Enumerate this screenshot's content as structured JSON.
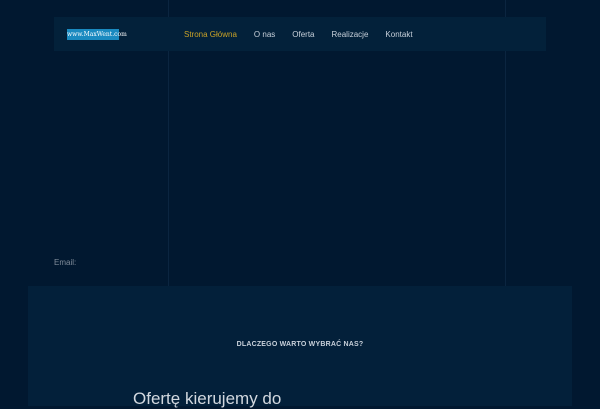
{
  "header": {
    "logo_text": "www.MaxWent.com",
    "nav": [
      {
        "label": "Strona Główna",
        "active": true
      },
      {
        "label": "O nas"
      },
      {
        "label": "Oferta"
      },
      {
        "label": "Realizacje"
      },
      {
        "label": "Kontakt"
      }
    ]
  },
  "contact": {
    "email_label": "Email:"
  },
  "why_section": {
    "eyebrow": "DLACZEGO WARTO WYBRAĆ NAS?",
    "heading": "Ofertę kierujemy do"
  }
}
